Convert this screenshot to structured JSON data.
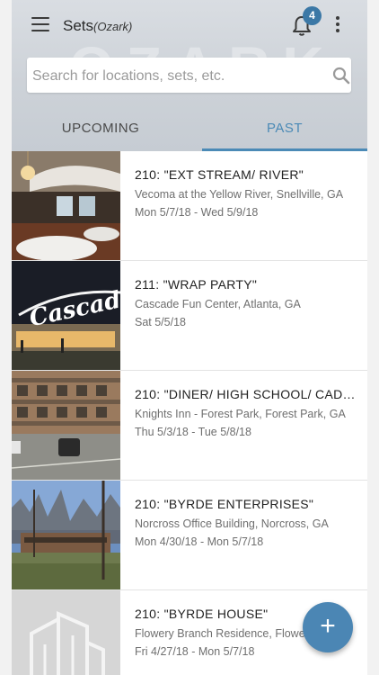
{
  "header": {
    "title": "Sets",
    "subtitle": "(Ozark)",
    "notification_count": "4",
    "watermark": "OZARK"
  },
  "search": {
    "placeholder": "Search for locations, sets, etc."
  },
  "tabs": [
    {
      "label": "UPCOMING",
      "active": false
    },
    {
      "label": "PAST",
      "active": true
    }
  ],
  "colors": {
    "accent": "#4b8ab6",
    "fab": "#4b86b4",
    "badge": "#3b78a6"
  },
  "sets": [
    {
      "title": "210: \"EXT STREAM/ RIVER\"",
      "location": "Vecoma at the Yellow River, Snellville, GA",
      "dates": "Mon 5/7/18 - Wed 5/9/18"
    },
    {
      "title": "211: \"WRAP PARTY\"",
      "location": "Cascade Fun Center, Atlanta, GA",
      "dates": "Sat 5/5/18",
      "sign_text": "Cascade"
    },
    {
      "title": "210: \"DINER/ HIGH SCHOOL/ CADE ...",
      "location": "Knights Inn - Forest Park, Forest Park, GA",
      "dates": "Thu 5/3/18 - Tue 5/8/18"
    },
    {
      "title": "210: \"BYRDE ENTERPRISES\"",
      "location": "Norcross Office Building, Norcross, GA",
      "dates": "Mon 4/30/18 - Mon 5/7/18"
    },
    {
      "title": "210: \"BYRDE HOUSE\"",
      "location": "Flowery Branch Residence, Flowe",
      "dates": "Fri 4/27/18 - Mon 5/7/18"
    }
  ],
  "fab": {
    "label": "+"
  }
}
